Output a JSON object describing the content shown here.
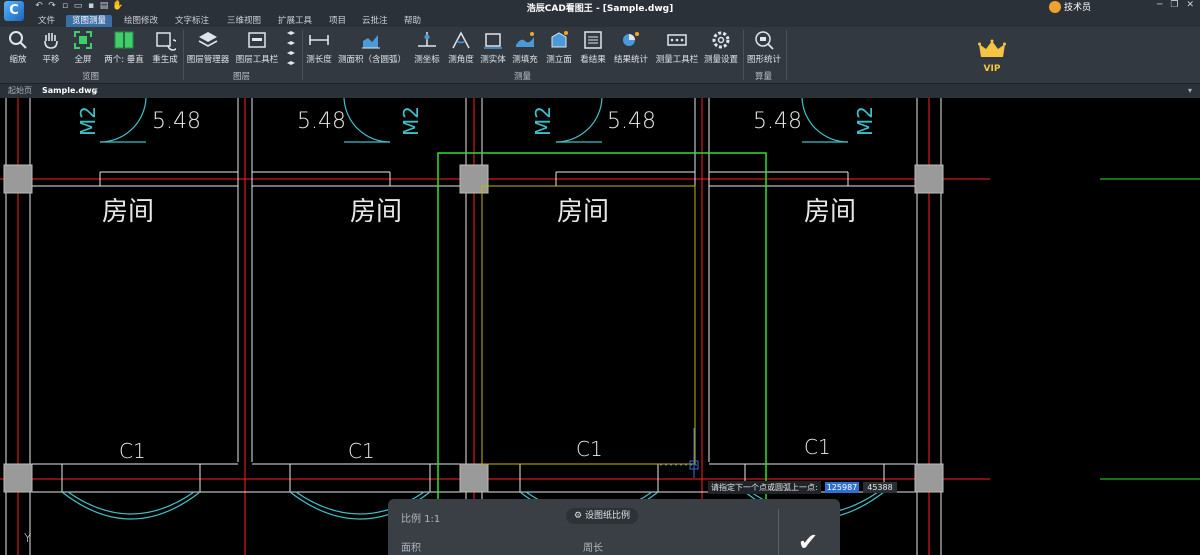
{
  "titlebar": {
    "title": "浩辰CAD看图王 - [Sample.dwg]",
    "user": "技术员",
    "quick_access_icons": [
      "undo-icon",
      "redo-icon",
      "new-file-icon",
      "open-file-icon",
      "save-icon",
      "print-icon",
      "hand-icon"
    ]
  },
  "menu": {
    "tabs": [
      "文件",
      "览图测量",
      "绘图修改",
      "文字标注",
      "三维视图",
      "扩展工具",
      "项目",
      "云批注",
      "帮助"
    ],
    "active": "览图测量"
  },
  "ribbon": {
    "buttons": {
      "zoom": "缩放",
      "pan": "平移",
      "fullscreen": "全屏",
      "two_vertical": "两个: 垂直",
      "regenerate": "重生成",
      "layer_manager": "图层管理器",
      "layer_toolbar": "图层工具栏",
      "measure_length": "测长度",
      "measure_area": "测面积（含圆弧）",
      "measure_coord": "测坐标",
      "measure_angle": "测角度",
      "measure_solid": "测实体",
      "measure_fill": "测填充",
      "measure_elev": "测立面",
      "view_result": "看结果",
      "result_stats": "结果统计",
      "measure_toolbar": "测量工具栏",
      "measure_settings": "测量设置",
      "shape_stats": "图形统计"
    },
    "groups": {
      "browse": "览图",
      "layers": "图层",
      "measure": "测量",
      "calc": "算量"
    },
    "vip_label": "VIP"
  },
  "doc_tabs": {
    "start": "起始页",
    "file": "Sample.dwg"
  },
  "drawing": {
    "door_dim": "5.48",
    "door_tag": "M2",
    "room_label": "房间",
    "window_tag": "C1",
    "ucs_label": "Y"
  },
  "prompt": {
    "text": "请指定下一个点或圆弧上一点:",
    "x_value": "125987",
    "y_value": "45388"
  },
  "measure_panel": {
    "scale": "比例 1:1",
    "set_scale_button": "设图纸比例",
    "area_label": "面积",
    "perimeter_label": "周长"
  },
  "colors": {
    "wall": "#ffffff",
    "door_swing": "#3fc0c8",
    "axis": "#ff2020",
    "measure_rect": "#2ee02e",
    "selection": "#c8b400"
  }
}
